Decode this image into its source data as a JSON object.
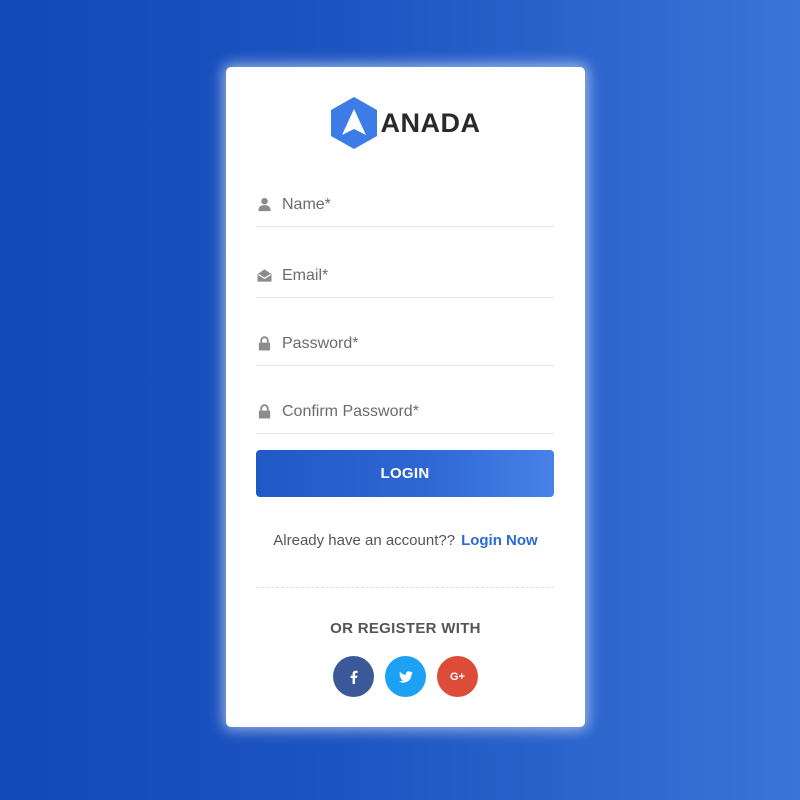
{
  "brand": {
    "name": "ANADA",
    "mark_color": "#3d7be6"
  },
  "form": {
    "fields": [
      {
        "placeholder": "Name*",
        "icon": "user-icon",
        "value": ""
      },
      {
        "placeholder": "Email*",
        "icon": "envelope-icon",
        "value": ""
      },
      {
        "placeholder": "Password*",
        "icon": "lock-icon",
        "value": ""
      },
      {
        "placeholder": "Confirm Password*",
        "icon": "lock-icon",
        "value": ""
      }
    ],
    "submit_label": "LOGIN"
  },
  "account_prompt": {
    "text": "Already have an account??",
    "link_label": "Login Now"
  },
  "social": {
    "heading": "OR REGISTER WITH",
    "buttons": [
      {
        "name": "facebook",
        "icon": "facebook-icon",
        "color": "#3b5998"
      },
      {
        "name": "twitter",
        "icon": "twitter-icon",
        "color": "#1da1f2"
      },
      {
        "name": "google-plus",
        "icon": "google-plus-icon",
        "color": "#dd4b39",
        "label": "G+"
      }
    ]
  },
  "colors": {
    "accent": "#2b6bd6",
    "background_start": "#1248b8",
    "background_end": "#3b74d8"
  }
}
